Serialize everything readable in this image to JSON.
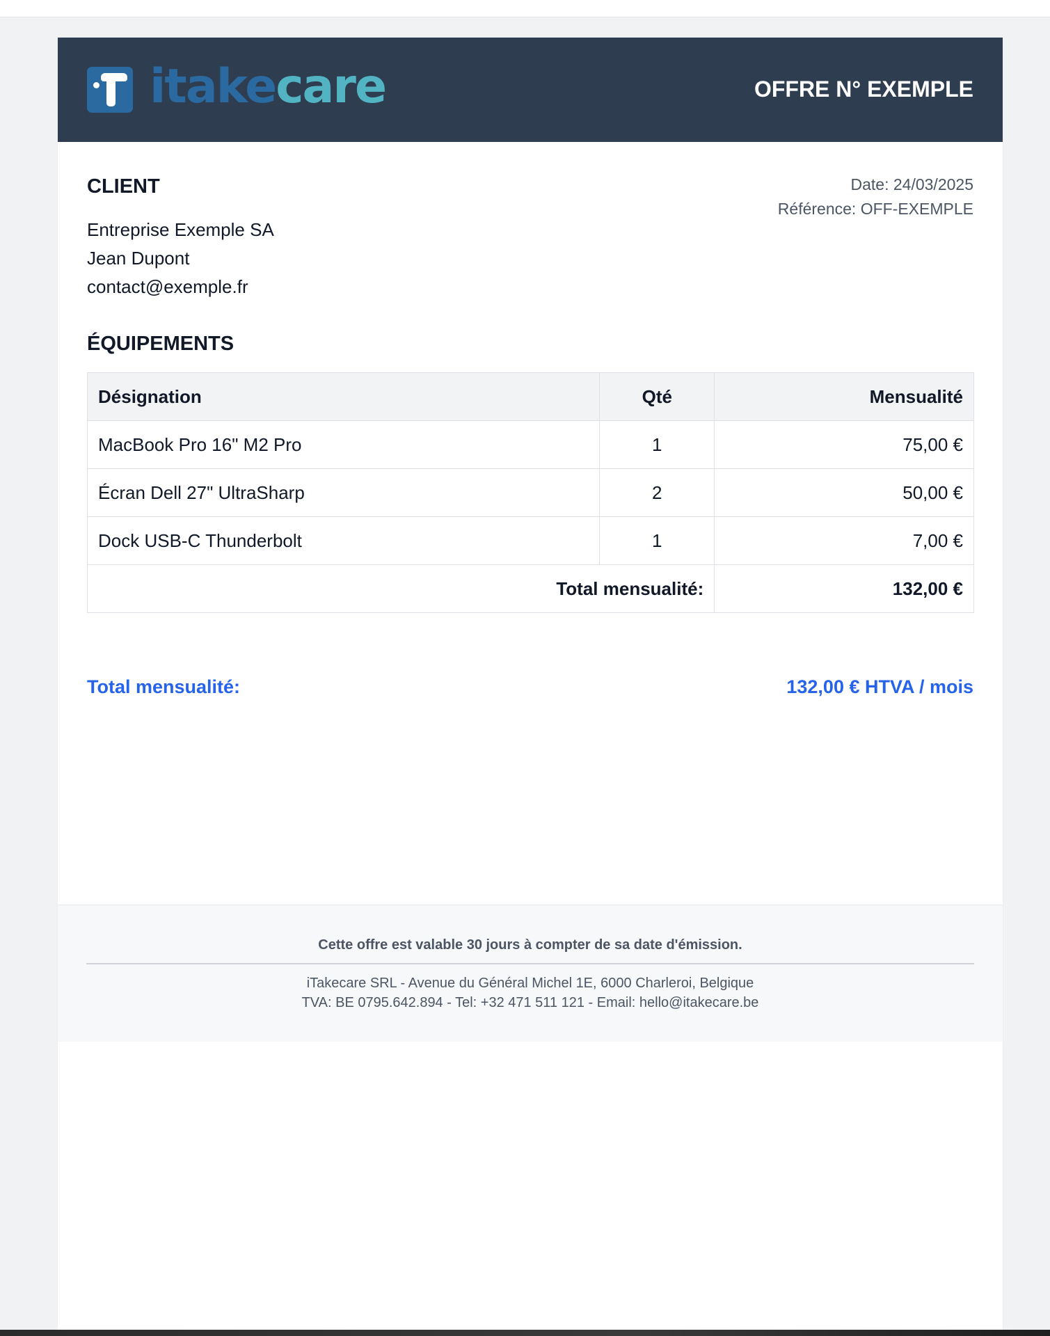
{
  "header": {
    "logo_text_part1": "itake",
    "logo_text_part2": "care",
    "offer_title": "OFFRE N° EXEMPLE"
  },
  "client": {
    "heading": "CLIENT",
    "company": "Entreprise Exemple SA",
    "contact_name": "Jean Dupont",
    "email": "contact@exemple.fr"
  },
  "meta": {
    "date": "Date: 24/03/2025",
    "reference": "Référence: OFF-EXEMPLE"
  },
  "equipment": {
    "heading": "ÉQUIPEMENTS",
    "columns": [
      "Désignation",
      "Qté",
      "Mensualité"
    ],
    "rows": [
      {
        "designation": "MacBook Pro 16\" M2 Pro",
        "qty": "1",
        "monthly": "75,00 €"
      },
      {
        "designation": "Écran Dell 27\" UltraSharp",
        "qty": "2",
        "monthly": "50,00 €"
      },
      {
        "designation": "Dock USB-C Thunderbolt",
        "qty": "1",
        "monthly": "7,00 €"
      }
    ],
    "total_label": "Total mensualité:",
    "total_value": "132,00 €"
  },
  "summary": {
    "label": "Total mensualité:",
    "value": "132,00 € HTVA / mois"
  },
  "footer": {
    "validity": "Cette offre est valable 30 jours à compter de sa date d'émission.",
    "company_line1": "iTakecare SRL - Avenue du Général Michel 1E, 6000 Charleroi, Belgique",
    "company_line2": "TVA: BE 0795.642.894 - Tel: +32 471 511 121 - Email: hello@itakecare.be"
  },
  "colors": {
    "header_bg": "#2e3d50",
    "logo_blue": "#2a6aa0",
    "logo_teal": "#52b4c3",
    "accent_blue": "#2563eb"
  }
}
